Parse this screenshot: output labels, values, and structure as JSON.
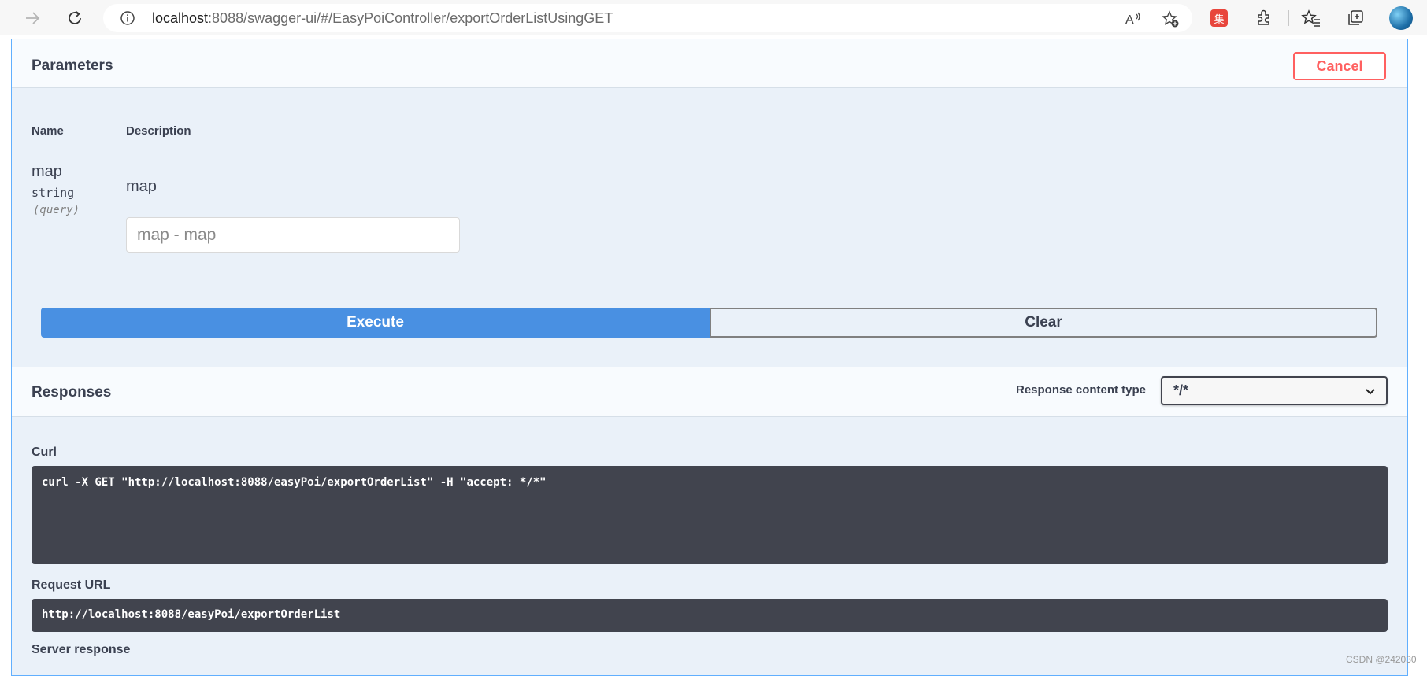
{
  "browser": {
    "url_host": "localhost",
    "url_rest": ":8088/swagger-ui/#/EasyPoiController/exportOrderListUsingGET",
    "extension_badge": "集"
  },
  "parameters": {
    "title": "Parameters",
    "cancel_label": "Cancel",
    "col_name": "Name",
    "col_description": "Description",
    "param_name": "map",
    "param_type": "string",
    "param_in": "(query)",
    "param_description": "map",
    "input_placeholder": "map - map"
  },
  "actions": {
    "execute_label": "Execute",
    "clear_label": "Clear"
  },
  "responses": {
    "title": "Responses",
    "content_type_label": "Response content type",
    "content_type_value": "*/*",
    "curl_label": "Curl",
    "curl_command": "curl -X GET \"http://localhost:8088/easyPoi/exportOrderList\" -H \"accept: */*\"",
    "request_url_label": "Request URL",
    "request_url": "http://localhost:8088/easyPoi/exportOrderList",
    "server_response_label": "Server response"
  },
  "watermark": "CSDN @242030",
  "colors": {
    "execute_blue": "#4990e2",
    "cancel_red": "#ff6060",
    "code_bg": "#41444e",
    "panel_bg": "#eaf1f9"
  }
}
